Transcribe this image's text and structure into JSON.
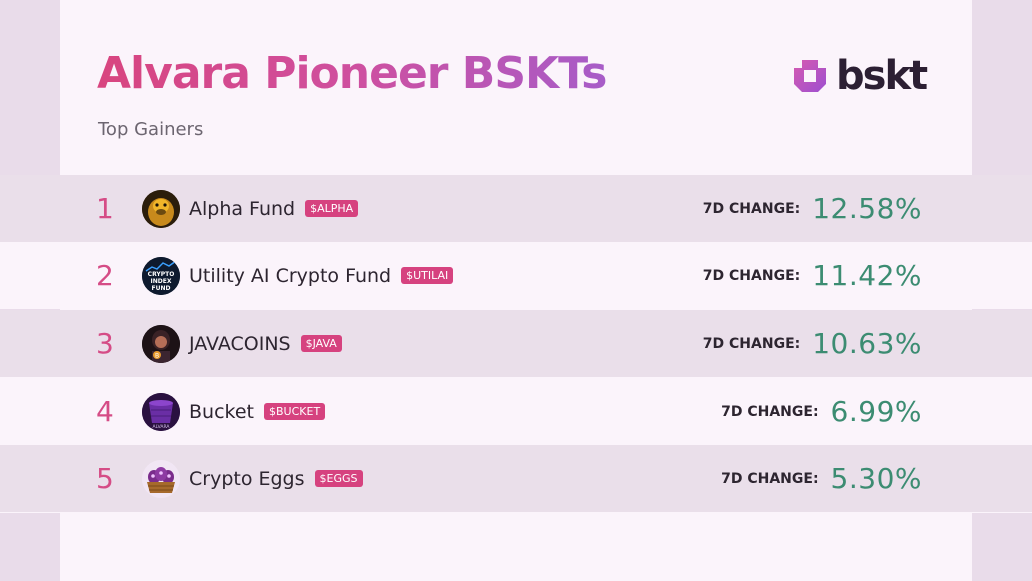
{
  "header": {
    "title": "Alvara Pioneer BSKTs",
    "subtitle": "Top Gainers"
  },
  "logo": {
    "text": "bskt",
    "icon": "bskt-logo-icon"
  },
  "colors": {
    "accent_pink": "#d6427f",
    "gain_green": "#3c8c72",
    "row_shade": "#eadfea",
    "row_light": "#fbf4fb"
  },
  "rows": [
    {
      "rank": "1",
      "name": "Alpha Fund",
      "ticker": "$ALPHA",
      "change_label": "7D CHANGE:",
      "change": "12.58%",
      "avatar_icon": "gorilla-avatar-icon"
    },
    {
      "rank": "2",
      "name": "Utility AI Crypto Fund",
      "ticker": "$UTILAI",
      "change_label": "7D CHANGE:",
      "change": "11.42%",
      "avatar_icon": "crypto-index-fund-avatar-icon",
      "avatar_text": "CRYPTO INDEX FUND"
    },
    {
      "rank": "3",
      "name": "JAVACOINS",
      "ticker": "$JAVA",
      "change_label": "7D CHANGE:",
      "change": "10.63%",
      "avatar_icon": "java-character-avatar-icon"
    },
    {
      "rank": "4",
      "name": "Bucket",
      "ticker": "$BUCKET",
      "change_label": "7D CHANGE:",
      "change": "6.99%",
      "avatar_icon": "bucket-avatar-icon",
      "avatar_text": "ALVARA"
    },
    {
      "rank": "5",
      "name": "Crypto Eggs",
      "ticker": "$EGGS",
      "change_label": "7D CHANGE:",
      "change": "5.30%",
      "avatar_icon": "eggs-basket-avatar-icon"
    }
  ]
}
